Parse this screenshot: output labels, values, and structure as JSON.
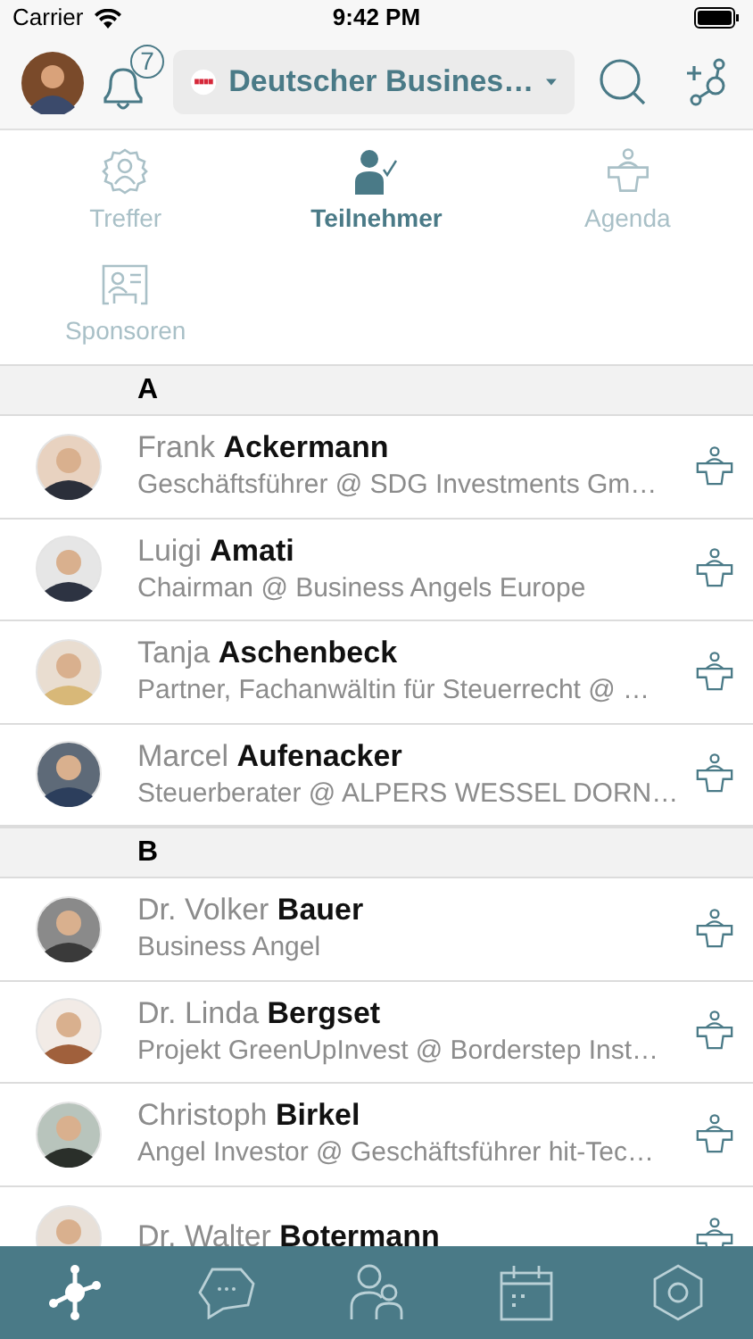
{
  "status_bar": {
    "carrier": "Carrier",
    "time": "9:42 PM"
  },
  "nav_bar": {
    "notification_count": "7",
    "event_selector": {
      "label": "Deutscher Busines…"
    }
  },
  "tabs": [
    {
      "label": "Treffer",
      "selected": false
    },
    {
      "label": "Teilnehmer",
      "selected": true
    },
    {
      "label": "Agenda",
      "selected": false
    },
    {
      "label": "Sponsoren",
      "selected": false
    }
  ],
  "sections": [
    {
      "letter": "A",
      "people": [
        {
          "name": "Frank **Ackermann**",
          "subtitle": "Geschäftsführer @ SDG Investments Gm…"
        },
        {
          "name": "Luigi **Amati**",
          "subtitle": "Chairman @ Business Angels Europe"
        },
        {
          "name": "Tanja **Aschenbeck**",
          "subtitle": "Partner, Fachanwältin für Steuerrecht @ …"
        },
        {
          "name": "Marcel **Aufenacker**",
          "subtitle": "Steuerberater @ ALPERS WESSEL DORN…"
        }
      ]
    },
    {
      "letter": "B",
      "people": [
        {
          "name": "Dr. Volker **Bauer**",
          "subtitle": "Business Angel"
        },
        {
          "name": "Dr. Linda **Bergset**",
          "subtitle": "Projekt GreenUpInvest @ Borderstep Inst…"
        },
        {
          "name": "Christoph **Birkel**",
          "subtitle": "Angel Investor @ Geschäftsführer hit-Tec…"
        },
        {
          "name": "Dr. Walter **Botermann**"
        }
      ]
    }
  ],
  "tab_bar": [
    {
      "selected": true
    },
    {
      "selected": false
    },
    {
      "selected": false
    },
    {
      "selected": false
    },
    {
      "selected": false
    }
  ]
}
